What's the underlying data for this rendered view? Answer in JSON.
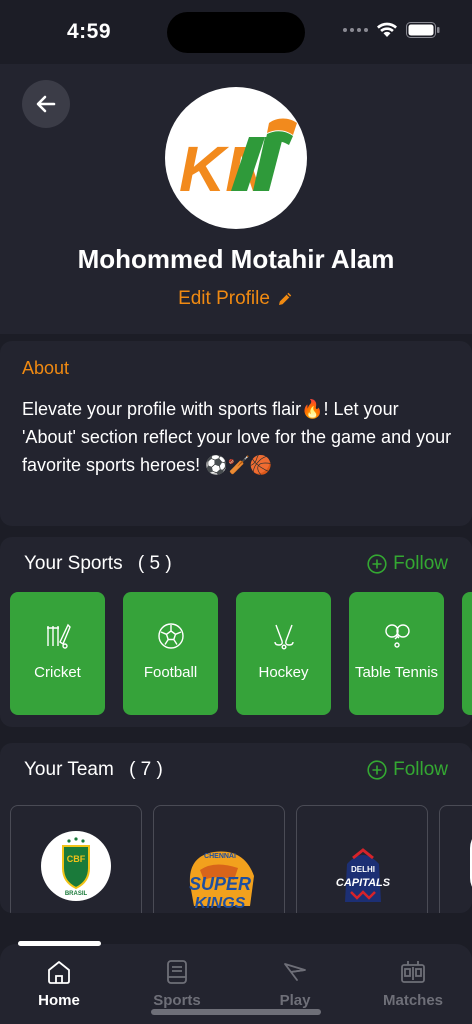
{
  "status": {
    "time": "4:59"
  },
  "profile": {
    "name": "Mohommed Motahir Alam",
    "edit_label": "Edit Profile",
    "logo_text": "KN"
  },
  "about": {
    "title": "About",
    "text": "Elevate your profile with sports flair🔥!  Let your 'About' section reflect your love for the game and your favorite sports heroes! ⚽🏏🏀"
  },
  "sports": {
    "title": "Your Sports",
    "count": "( 5 )",
    "follow_label": "Follow",
    "items": [
      {
        "label": "Cricket",
        "icon": "cricket-icon"
      },
      {
        "label": "Football",
        "icon": "football-icon"
      },
      {
        "label": "Hockey",
        "icon": "hockey-icon"
      },
      {
        "label": "Table Tennis",
        "icon": "table-tennis-icon"
      }
    ]
  },
  "teams": {
    "title": "Your Team",
    "count": "( 7 )",
    "follow_label": "Follow",
    "items": [
      {
        "name": "BRASIL",
        "logo_line1": "CBF"
      },
      {
        "name": "CHENNAI",
        "logo_line1": "SUPER",
        "logo_line2": "KINGS"
      },
      {
        "name": "DELHI",
        "logo_line1": "CAPITALS"
      }
    ]
  },
  "tabs": [
    {
      "label": "Home",
      "icon": "home-icon",
      "active": true
    },
    {
      "label": "Sports",
      "icon": "book-icon",
      "active": false
    },
    {
      "label": "Play",
      "icon": "paper-plane-icon",
      "active": false
    },
    {
      "label": "Matches",
      "icon": "scoreboard-icon",
      "active": false
    }
  ],
  "colors": {
    "accent_orange": "#f08a12",
    "accent_green": "#36a33a",
    "background": "#1c1d26",
    "card": "#23242f"
  }
}
